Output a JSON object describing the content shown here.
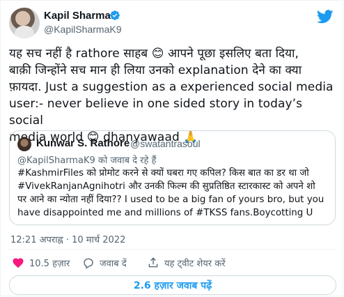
{
  "author": {
    "name": "Kapil Sharma",
    "handle": "@KapilSharmaK9"
  },
  "tweet": {
    "line1": "यह सच नहीं है rathore साहब 😊 आपने पूछा इसलिए बता दिया,",
    "line2": "बाक़ी जिन्होंने सच मान ही लिया उनको explanation देने का क्या",
    "line3": "फ़ायदा. Just a suggestion as a experienced social media",
    "line4": "user:- never believe in one sided story in today’s social",
    "line5": "media world 😊 dhanyawaad 🙏"
  },
  "quoted": {
    "name": "Kunwar S. Rathore",
    "handle": "@swatantrasoul",
    "reply_line": "@KapilSharmaK9 को जवाब दे रहे हैं",
    "line1": "#KashmirFiles को प्रोमोट करने से क्यों घबरा गए कपिल? किस बात का डर था जो",
    "line2": "#VivekRanjanAgnihotri और उनकी फिल्म की सुप्रतिष्ठित स्टारकास्ट को अपने शो",
    "line3": "पर आने का न्योता नहीं दिया?? I used to be a big fan of yours bro, but you",
    "line4": "have disappointed me and millions of #TKSS fans.Boycotting U"
  },
  "meta": {
    "timestamp": "12:21 अपराह्न · 10 मार्च 2022"
  },
  "actions": {
    "likes": "10.5 हज़ार",
    "reply": "जवाब दें",
    "share": "यह ट्वीट शेयर करें"
  },
  "more_replies": "2.6 हज़ार जवाब पढ़ें",
  "colors": {
    "accent": "#1d9bf0",
    "like": "#f91880",
    "secondary_text": "#536471"
  }
}
